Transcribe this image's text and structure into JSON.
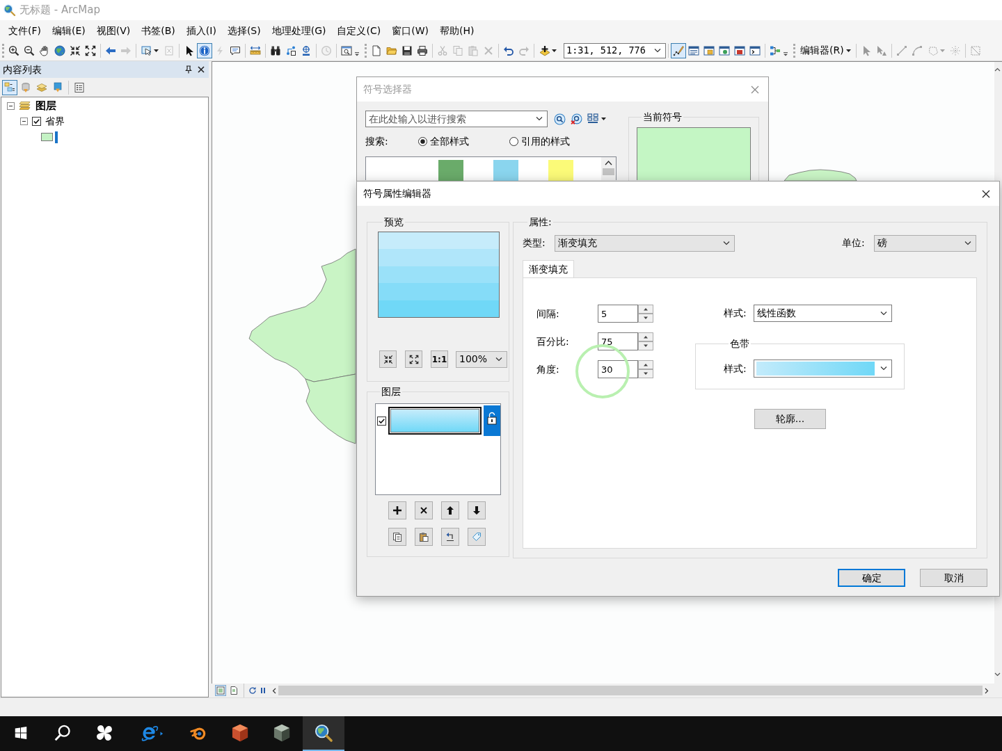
{
  "window": {
    "title": "无标题 - ArcMap"
  },
  "menu": [
    "文件(F)",
    "编辑(E)",
    "视图(V)",
    "书签(B)",
    "插入(I)",
    "选择(S)",
    "地理处理(G)",
    "自定义(C)",
    "窗口(W)",
    "帮助(H)"
  ],
  "toolbars": [
    {
      "overflow": true,
      "sections": [
        [
          {
            "kind": "zoom-in",
            "selected": false,
            "disabled": false
          },
          {
            "kind": "zoom-out",
            "selected": false,
            "disabled": false
          },
          {
            "kind": "pan",
            "selected": false,
            "disabled": false
          },
          {
            "kind": "full-extent",
            "selected": false,
            "disabled": false
          },
          {
            "kind": "fixed-zoom-in",
            "selected": false,
            "disabled": false
          },
          {
            "kind": "fixed-zoom-out",
            "selected": false,
            "disabled": false
          }
        ],
        [
          {
            "kind": "back",
            "selected": false,
            "disabled": false
          },
          {
            "kind": "forward",
            "selected": false,
            "disabled": true
          }
        ],
        [
          {
            "kind": "select-features",
            "selected": false,
            "disabled": false,
            "dropdown": true
          },
          {
            "kind": "clear-selection",
            "selected": false,
            "disabled": true
          }
        ],
        [
          {
            "kind": "select-elements",
            "selected": false,
            "disabled": false
          },
          {
            "kind": "identify",
            "selected": true,
            "disabled": false
          },
          {
            "kind": "hyperlink",
            "selected": false,
            "disabled": true
          },
          {
            "kind": "html-popup",
            "selected": false,
            "disabled": false
          }
        ],
        [
          {
            "kind": "measure",
            "selected": false,
            "disabled": false
          }
        ],
        [
          {
            "kind": "find",
            "selected": false,
            "disabled": false
          },
          {
            "kind": "route",
            "selected": false,
            "disabled": false
          },
          {
            "kind": "go-to-xy",
            "selected": false,
            "disabled": false
          }
        ],
        [
          {
            "kind": "time-slider",
            "selected": false,
            "disabled": true
          }
        ],
        [
          {
            "kind": "viewer",
            "selected": false,
            "disabled": false
          }
        ]
      ]
    },
    {
      "overflow": true,
      "sections": [
        [
          {
            "kind": "new",
            "selected": false,
            "disabled": false
          },
          {
            "kind": "open",
            "selected": false,
            "disabled": false
          },
          {
            "kind": "save",
            "selected": false,
            "disabled": false
          },
          {
            "kind": "print",
            "selected": false,
            "disabled": false
          }
        ],
        [
          {
            "kind": "cut",
            "selected": false,
            "disabled": true
          },
          {
            "kind": "copy",
            "selected": false,
            "disabled": true
          },
          {
            "kind": "paste",
            "selected": false,
            "disabled": true
          },
          {
            "kind": "delete",
            "selected": false,
            "disabled": true
          }
        ],
        [
          {
            "kind": "undo",
            "selected": false,
            "disabled": false
          },
          {
            "kind": "redo",
            "selected": false,
            "disabled": true
          }
        ],
        [
          {
            "kind": "add-data",
            "selected": false,
            "disabled": false,
            "dropdown": true
          },
          {
            "kind": "scale",
            "value": "1:31, 512, 776",
            "selected": false,
            "disabled": false
          }
        ],
        [
          {
            "kind": "editor-toolbar",
            "selected": true,
            "disabled": false
          },
          {
            "kind": "toc-window",
            "selected": false,
            "disabled": false
          },
          {
            "kind": "catalog-window",
            "selected": false,
            "disabled": false
          },
          {
            "kind": "search-window",
            "selected": false,
            "disabled": false
          },
          {
            "kind": "toolbox-window",
            "selected": false,
            "disabled": false
          },
          {
            "kind": "python-window",
            "selected": false,
            "disabled": false
          }
        ],
        [
          {
            "kind": "model-builder",
            "selected": false,
            "disabled": false
          }
        ]
      ]
    },
    {
      "overflow": false,
      "sections": [
        [
          {
            "kind": "menu",
            "label": "编辑器(R)",
            "selected": false,
            "disabled": false,
            "dropdown": true
          }
        ],
        [
          {
            "kind": "edit-tool",
            "selected": false,
            "disabled": true
          },
          {
            "kind": "annotation-tool",
            "selected": false,
            "disabled": true
          }
        ],
        [
          {
            "kind": "straight-segment",
            "selected": false,
            "disabled": true
          },
          {
            "kind": "arc-segment",
            "selected": false,
            "disabled": true
          },
          {
            "kind": "construction-tool",
            "selected": false,
            "disabled": true,
            "dropdown": true
          },
          {
            "kind": "midpoint-tool",
            "selected": false,
            "disabled": true
          }
        ],
        [
          {
            "kind": "cut-polygons",
            "selected": false,
            "disabled": true
          }
        ]
      ]
    }
  ],
  "toc": {
    "title": "内容列表",
    "tool_sections": [
      [
        {
          "kind": "drawing-order",
          "selected": true
        },
        {
          "kind": "source",
          "selected": false
        },
        {
          "kind": "visibility",
          "selected": false
        },
        {
          "kind": "selection",
          "selected": false
        }
      ],
      [
        {
          "kind": "options",
          "selected": false
        }
      ]
    ],
    "tree": [
      {
        "kind": "data-frame",
        "label": "图层",
        "expanded": true,
        "children": [
          {
            "kind": "layer",
            "label": "省界",
            "checked": true,
            "expanded": true
          }
        ]
      }
    ]
  },
  "map_view": {
    "views": [
      {
        "kind": "data",
        "selected": true
      },
      {
        "kind": "layout",
        "selected": false
      }
    ]
  },
  "symbol_selector": {
    "title": "符号选择器",
    "search": {
      "placeholder": "在此处输入以进行搜索"
    },
    "search_label": "搜索:",
    "scopes": [
      {
        "label": "全部样式",
        "selected": true
      },
      {
        "label": "引用的样式",
        "selected": false
      }
    ],
    "gallery": [
      {
        "color": "#6aab6a"
      },
      {
        "color": "#8ad5ee"
      },
      {
        "color": "#fbfa78"
      }
    ],
    "current_symbol": {
      "label": "当前符号"
    }
  },
  "symbol_editor": {
    "title": "符号属性编辑器",
    "preview": {
      "label": "预览",
      "actual_size": "1:1",
      "zoom": "100%"
    },
    "layers": {
      "label": "图层",
      "items": [
        {
          "checked": true,
          "selected": true
        }
      ]
    },
    "properties": {
      "label": "属性:",
      "type": {
        "label": "类型:",
        "value": "渐变填充"
      },
      "unit": {
        "label": "单位:",
        "value": "磅"
      },
      "tabs": [
        {
          "label": "渐变填充",
          "selected": true
        }
      ],
      "fields": [
        {
          "label": "间隔:",
          "value": "5"
        },
        {
          "label": "百分比:",
          "value": "75"
        },
        {
          "label": "角度:",
          "value": "30"
        }
      ],
      "style": {
        "label": "样式:",
        "value": "线性函数"
      },
      "color_ramp": {
        "label": "色带",
        "style_label": "样式:"
      },
      "outline_button": "轮廓..."
    },
    "buttons": [
      {
        "label": "确定",
        "default": true
      },
      {
        "label": "取消",
        "default": false
      }
    ]
  },
  "taskbar": [
    {
      "kind": "start",
      "selected": false
    },
    {
      "kind": "search",
      "selected": false
    },
    {
      "kind": "pinwheel",
      "selected": false
    },
    {
      "kind": "browser",
      "selected": false
    },
    {
      "kind": "ring-app",
      "selected": false
    },
    {
      "kind": "cube",
      "selected": false
    },
    {
      "kind": "dark-cube",
      "selected": false
    },
    {
      "kind": "arcmap",
      "selected": true
    }
  ]
}
